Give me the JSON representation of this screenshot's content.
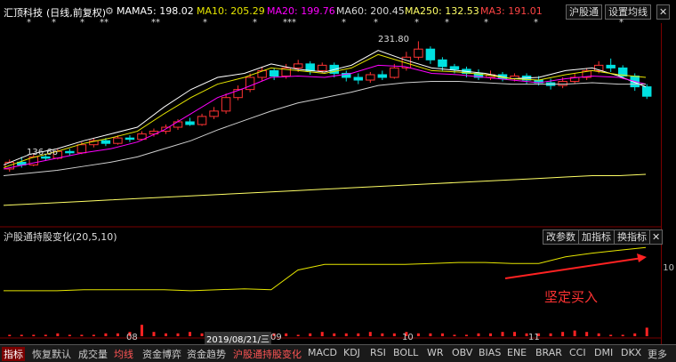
{
  "header": {
    "stock_name": "汇顶科技",
    "mode": "(日线,前复权)",
    "ma_label": "MA",
    "ma5": "MA5: 198.02",
    "ma10": "MA10: 205.29",
    "ma20": "MA20: 199.76",
    "ma60": "MA60: 200.45",
    "ma250": "MA250: 132.53",
    "ma3": "MA3: 191.01",
    "hgt_button": "沪股通",
    "set_ma_button": "设置均线",
    "colors": {
      "ma5": "#ffffff",
      "ma10": "#e6e600",
      "ma20": "#ff00ff",
      "ma60": "#00ff00",
      "ma250": "#ffff66",
      "ma3": "#ff4444"
    }
  },
  "price_chart": {
    "high_label": "231.80",
    "low_label": "136.66"
  },
  "indicator": {
    "title": "沪股通持股变化(20,5,10)",
    "btn_change_params": "改参数",
    "btn_add_indicator": "加指标",
    "btn_switch_indicator": "换指标",
    "close": "✕",
    "annotation": "坚定买入"
  },
  "right_axis": {
    "label": "10"
  },
  "time_axis": {
    "labels": [
      "08",
      "09",
      "10",
      "11"
    ],
    "cursor_date": "2019/08/21/三"
  },
  "tabs": [
    "指标",
    "恢复默认",
    "成交量",
    "均线",
    "资金博弈",
    "资金趋势",
    "沪股通持股变化",
    "MACD",
    "KDJ",
    "RSI",
    "BOLL",
    "WR",
    "OBV",
    "BIAS",
    "ENE",
    "BRAR",
    "CCI",
    "DMI",
    "DKX",
    "更多"
  ],
  "chart_data": {
    "type": "line",
    "x": [
      0,
      10,
      20,
      30,
      40,
      50,
      60,
      70,
      80,
      90,
      100,
      110,
      120,
      130,
      140,
      150,
      160,
      170,
      180,
      190,
      200,
      210,
      220,
      230,
      240
    ],
    "series": [
      {
        "name": "MA5",
        "values": [
          140,
          148,
          152,
          158,
          163,
          168,
          183,
          196,
          205,
          208,
          215,
          211,
          209,
          214,
          225,
          218,
          212,
          210,
          208,
          204,
          205,
          210,
          212,
          206,
          198
        ]
      },
      {
        "name": "MA10",
        "values": [
          138,
          145,
          150,
          156,
          160,
          165,
          178,
          190,
          200,
          205,
          212,
          210,
          208,
          212,
          222,
          216,
          210,
          209,
          207,
          204,
          203,
          207,
          210,
          207,
          205
        ]
      },
      {
        "name": "MA20",
        "values": [
          137,
          141,
          145,
          149,
          152,
          157,
          166,
          178,
          190,
          197,
          205,
          206,
          205,
          208,
          214,
          213,
          208,
          207,
          205,
          203,
          201,
          204,
          206,
          205,
          200
        ]
      },
      {
        "name": "MA60",
        "values": [
          132,
          134,
          136,
          139,
          142,
          146,
          152,
          158,
          166,
          173,
          180,
          186,
          190,
          194,
          199,
          201,
          202,
          202,
          201,
          200,
          200,
          200,
          201,
          200,
          200
        ]
      },
      {
        "name": "MA250",
        "values": [
          110,
          111,
          112,
          113,
          114,
          115,
          116,
          117,
          118,
          119,
          120,
          121,
          122,
          123,
          124,
          125,
          126,
          127,
          128,
          129,
          130,
          131,
          132,
          132,
          133
        ]
      },
      {
        "name": "沪股通持股变化",
        "values": [
          20,
          20,
          20,
          21,
          21,
          21,
          21,
          20,
          21,
          22,
          21,
          42,
          48,
          48,
          48,
          48,
          49,
          50,
          50,
          49,
          49,
          56,
          60,
          63,
          66
        ]
      }
    ],
    "candles": [
      [
        0,
        137,
        142,
        135,
        144
      ],
      [
        1,
        142,
        140,
        138,
        146
      ],
      [
        2,
        140,
        146,
        139,
        148
      ],
      [
        3,
        146,
        145,
        143,
        148
      ],
      [
        4,
        145,
        150,
        144,
        152
      ],
      [
        5,
        150,
        149,
        147,
        152
      ],
      [
        6,
        149,
        155,
        148,
        157
      ],
      [
        7,
        155,
        158,
        153,
        160
      ],
      [
        8,
        158,
        156,
        154,
        160
      ],
      [
        9,
        156,
        160,
        155,
        162
      ],
      [
        10,
        160,
        159,
        157,
        162
      ],
      [
        11,
        159,
        163,
        158,
        165
      ],
      [
        12,
        163,
        165,
        161,
        167
      ],
      [
        13,
        165,
        168,
        163,
        170
      ],
      [
        14,
        168,
        172,
        166,
        174
      ],
      [
        15,
        172,
        170,
        169,
        175
      ],
      [
        16,
        170,
        176,
        169,
        178
      ],
      [
        17,
        176,
        180,
        174,
        183
      ],
      [
        18,
        180,
        190,
        178,
        193
      ],
      [
        19,
        190,
        196,
        188,
        199
      ],
      [
        20,
        196,
        205,
        194,
        208
      ],
      [
        21,
        205,
        210,
        202,
        213
      ],
      [
        22,
        210,
        206,
        203,
        212
      ],
      [
        23,
        206,
        212,
        204,
        215
      ],
      [
        24,
        212,
        215,
        209,
        218
      ],
      [
        25,
        215,
        210,
        207,
        217
      ],
      [
        26,
        210,
        214,
        208,
        216
      ],
      [
        27,
        214,
        208,
        205,
        216
      ],
      [
        28,
        208,
        205,
        202,
        210
      ],
      [
        29,
        205,
        203,
        200,
        208
      ],
      [
        30,
        203,
        207,
        201,
        209
      ],
      [
        31,
        207,
        205,
        203,
        210
      ],
      [
        32,
        205,
        212,
        204,
        215
      ],
      [
        33,
        212,
        220,
        210,
        224
      ],
      [
        34,
        220,
        226,
        218,
        231.8
      ],
      [
        35,
        226,
        218,
        215,
        228
      ],
      [
        36,
        218,
        213,
        210,
        220
      ],
      [
        37,
        213,
        211,
        208,
        215
      ],
      [
        38,
        211,
        208,
        205,
        213
      ],
      [
        39,
        208,
        205,
        203,
        211
      ],
      [
        40,
        205,
        207,
        203,
        210
      ],
      [
        41,
        207,
        204,
        202,
        209
      ],
      [
        42,
        204,
        206,
        202,
        208
      ],
      [
        43,
        206,
        203,
        200,
        208
      ],
      [
        44,
        203,
        201,
        199,
        206
      ],
      [
        45,
        201,
        199,
        196,
        204
      ],
      [
        46,
        199,
        202,
        197,
        205
      ],
      [
        47,
        202,
        205,
        200,
        208
      ],
      [
        48,
        205,
        210,
        203,
        212
      ],
      [
        49,
        210,
        214,
        208,
        217
      ],
      [
        50,
        214,
        212,
        209,
        219
      ],
      [
        51,
        212,
        206,
        204,
        214
      ],
      [
        52,
        206,
        198,
        195,
        208
      ],
      [
        53,
        198,
        191,
        189,
        200
      ]
    ],
    "volume": [
      1,
      1,
      1,
      1,
      2,
      1,
      1,
      1,
      2,
      2,
      3,
      8,
      3,
      2,
      2,
      3,
      2,
      2,
      2,
      1,
      1,
      2,
      2,
      2,
      1,
      2,
      3,
      2,
      2,
      2,
      3,
      2,
      2,
      3,
      2,
      2,
      2,
      1,
      1,
      2,
      2,
      3,
      3,
      2,
      2,
      2,
      3,
      4,
      3,
      2,
      1,
      1,
      2,
      6
    ],
    "ylim": [
      100,
      240
    ]
  }
}
